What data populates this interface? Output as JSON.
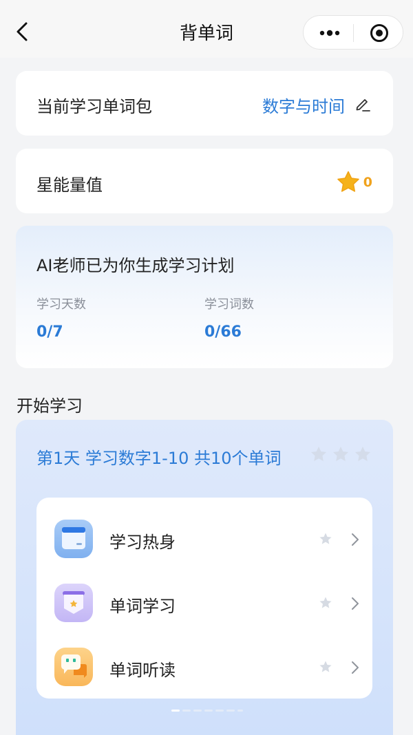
{
  "header": {
    "title": "背单词",
    "back_icon": "chevron-left-icon",
    "more_icon": "more-dots-icon",
    "close_icon": "target-circle-icon"
  },
  "word_pack": {
    "label": "当前学习单词包",
    "value": "数字与时间",
    "edit_icon": "pencil-icon"
  },
  "energy": {
    "label": "星能量值",
    "count": "0",
    "star_color": "#f5b21b"
  },
  "plan": {
    "title": "AI老师已为你生成学习计划",
    "days_label": "学习天数",
    "days_value": "0/7",
    "words_label": "学习词数",
    "words_value": "0/66"
  },
  "section_title": "开始学习",
  "study": {
    "day_title": "第1天   学习数字1-10 共10个单词",
    "items": [
      {
        "label": "学习热身",
        "icon": "calendar-card-icon"
      },
      {
        "label": "单词学习",
        "icon": "star-badge-icon"
      },
      {
        "label": "单词听读",
        "icon": "chat-bubble-icon"
      }
    ]
  },
  "colors": {
    "accent": "#2b7bd6",
    "background": "#f3f4f6"
  }
}
